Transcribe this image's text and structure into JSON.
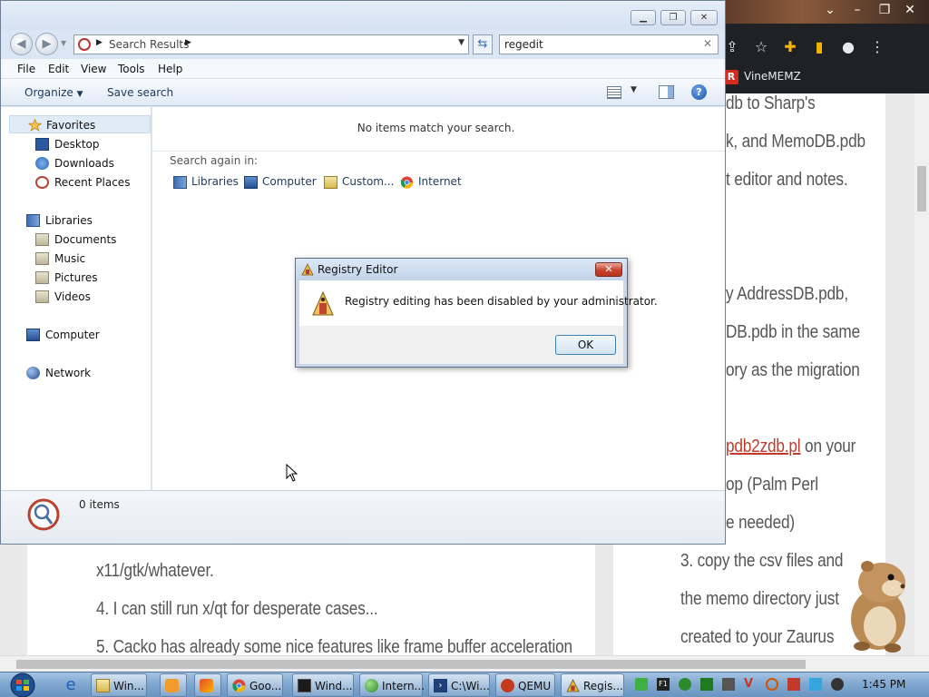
{
  "browser": {
    "toolbar_icons": [
      "share-icon",
      "star-icon",
      "puzzle-icon",
      "sidebar-icon",
      "profile-icon",
      "kebab-menu-icon"
    ],
    "bookmark_label": "VineMEMZ",
    "bookmark_logo": "R",
    "right_column_lines": [
      "db to Sharp's",
      "k, and MemoDB.pdb",
      "t editor and notes.",
      "y AddressDB.pdb,",
      "DB.pdb in the same",
      "ory as the migration",
      "on your",
      "op (Palm Perl",
      "e needed)",
      "3. copy the csv files and",
      "the memo directory just",
      "created to your Zaurus"
    ],
    "right_link": "pdb2zdb.pl",
    "left_column_lines": [
      "x11/gtk/whatever.",
      "4. I can still run x/qt for desperate cases...",
      "5. Cacko has already some nice features like frame buffer acceleration"
    ]
  },
  "explorer": {
    "address": {
      "path": "Search Results",
      "search_value": "regedit"
    },
    "menu": [
      "File",
      "Edit",
      "View",
      "Tools",
      "Help"
    ],
    "commands": {
      "organize": "Organize",
      "save_search": "Save search"
    },
    "nav": {
      "favorites": "Favorites",
      "desktop": "Desktop",
      "downloads": "Downloads",
      "recent_places": "Recent Places",
      "libraries": "Libraries",
      "documents": "Documents",
      "music": "Music",
      "pictures": "Pictures",
      "videos": "Videos",
      "computer": "Computer",
      "network": "Network"
    },
    "content": {
      "empty_message": "No items match your search.",
      "search_again_label": "Search again in:",
      "locations": [
        "Libraries",
        "Computer",
        "Custom...",
        "Internet"
      ]
    },
    "details": {
      "count_text": "0 items"
    }
  },
  "dialog": {
    "title": "Registry Editor",
    "message": "Registry editing has been disabled by your administrator.",
    "ok_label": "OK"
  },
  "taskbar": {
    "tasks": [
      "Win...",
      "",
      "",
      "Goo...",
      "Wind...",
      "Intern...",
      "C:\\Wi...",
      "QEMU",
      "Regis..."
    ],
    "clock": "1:45 PM"
  }
}
